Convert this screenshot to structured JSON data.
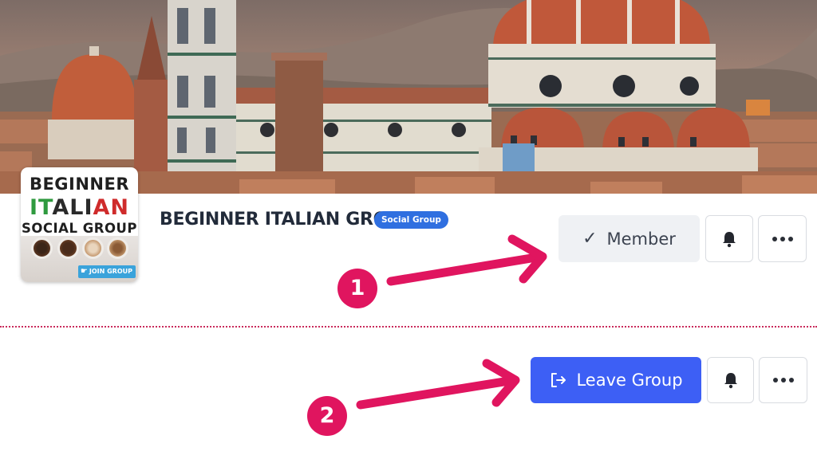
{
  "avatar": {
    "line1": "BEGINNER",
    "line2_parts": [
      "IT",
      "ALI",
      "AN"
    ],
    "line3": "SOCIAL GROUP",
    "badge": "JOIN GROUP"
  },
  "group": {
    "title": "BEGINNER ITALIAN GROUP",
    "type": "Social Group"
  },
  "state1": {
    "member_label": "Member"
  },
  "state2": {
    "leave_label": "Leave Group"
  },
  "annotations": {
    "step1": "1",
    "step2": "2"
  },
  "icons": {
    "member": "check-icon",
    "leave": "exit-icon",
    "notify": "bell-icon",
    "more": "more-dots-icon",
    "join_badge": "hand-pointer-icon"
  },
  "colors": {
    "primary": "#3d5ff5",
    "pill": "#2f6fe0",
    "annotation": "#e0155f",
    "member_bg": "#eff1f4",
    "title": "#222b3a"
  }
}
